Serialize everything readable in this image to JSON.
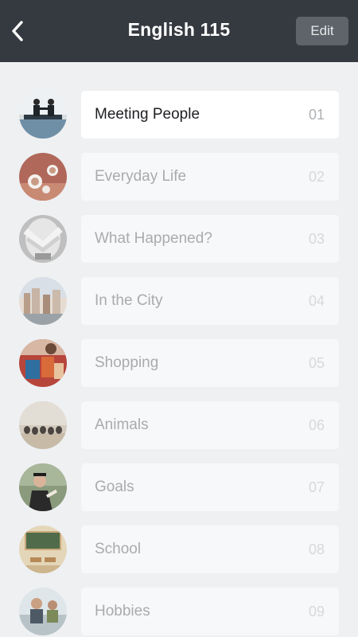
{
  "header": {
    "title": "English 115",
    "edit_label": "Edit",
    "back_icon": "chevron-left-icon"
  },
  "colors": {
    "header_bg": "#353a40",
    "page_bg": "#eef0f2",
    "active_card": "#ffffff",
    "inactive_card": "#f7f8f9"
  },
  "lessons": [
    {
      "label": "Meeting People",
      "number": "01",
      "active": true
    },
    {
      "label": "Everyday Life",
      "number": "02",
      "active": false
    },
    {
      "label": "What Happened?",
      "number": "03",
      "active": false
    },
    {
      "label": "In the City",
      "number": "04",
      "active": false
    },
    {
      "label": "Shopping",
      "number": "05",
      "active": false
    },
    {
      "label": "Animals",
      "number": "06",
      "active": false
    },
    {
      "label": "Goals",
      "number": "07",
      "active": false
    },
    {
      "label": "School",
      "number": "08",
      "active": false
    },
    {
      "label": "Hobbies",
      "number": "09",
      "active": false
    }
  ]
}
